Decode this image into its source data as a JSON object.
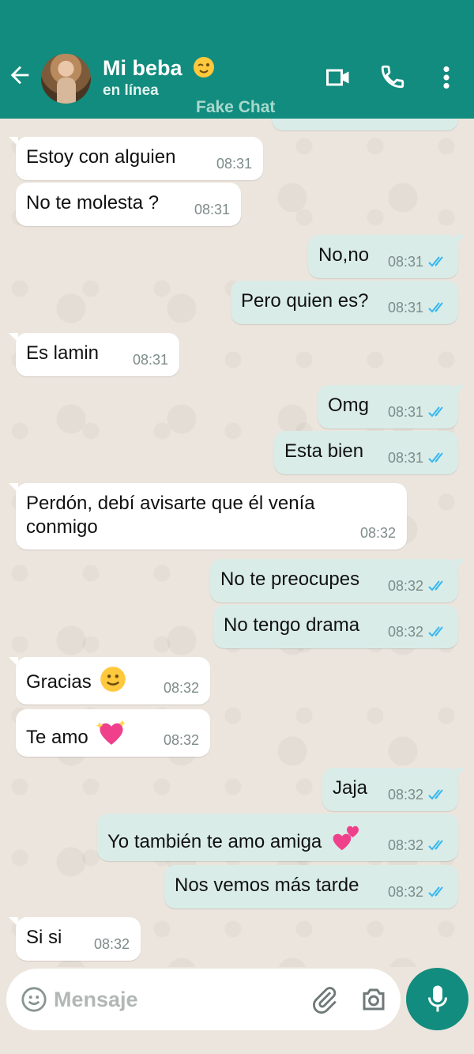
{
  "header": {
    "name": "Mi beba",
    "name_emoji": "winking-face-emoji",
    "status": "en línea",
    "watermark": "Fake Chat",
    "icons": [
      "back-arrow-icon",
      "video-call-icon",
      "phone-icon",
      "more-vert-icon"
    ],
    "background": "#128c7e"
  },
  "messages": [
    {
      "dir": "in",
      "text": "Estoy con alguien",
      "time": "08:31"
    },
    {
      "dir": "in",
      "text": "No te molesta ?",
      "time": "08:31"
    },
    {
      "dir": "out",
      "text": "No,no",
      "time": "08:31",
      "read": true
    },
    {
      "dir": "out",
      "text": "Pero quien es?",
      "time": "08:31",
      "read": true
    },
    {
      "dir": "in",
      "text": "Es lamin",
      "time": "08:31"
    },
    {
      "dir": "out",
      "text": "Omg",
      "time": "08:31",
      "read": true
    },
    {
      "dir": "out",
      "text": "Esta bien",
      "time": "08:31",
      "read": true
    },
    {
      "dir": "in",
      "text": "Perdón, debí avisarte que él venía conmigo",
      "time": "08:32"
    },
    {
      "dir": "out",
      "text": "No te preocupes",
      "time": "08:32",
      "read": true
    },
    {
      "dir": "out",
      "text": "No tengo drama",
      "time": "08:32",
      "read": true
    },
    {
      "dir": "in",
      "text": "Gracias",
      "emoji": "slightly-smiling-face-emoji",
      "time": "08:32"
    },
    {
      "dir": "in",
      "text": "Te amo",
      "emoji": "sparkling-heart-emoji",
      "time": "08:32"
    },
    {
      "dir": "out",
      "text": "Jaja",
      "time": "08:32",
      "read": true
    },
    {
      "dir": "out",
      "text": "Yo también te amo amiga",
      "emoji": "two-hearts-emoji",
      "time": "08:32",
      "read": true
    },
    {
      "dir": "out",
      "text": "Nos vemos más tarde",
      "time": "08:32",
      "read": true
    },
    {
      "dir": "in",
      "text": "Si si",
      "time": "08:32"
    }
  ],
  "input": {
    "placeholder": "Mensaje",
    "icons": [
      "emoji-icon",
      "attach-icon",
      "camera-icon",
      "mic-icon"
    ]
  },
  "colors": {
    "incoming_bubble": "#ffffff",
    "outgoing_bubble": "#d9ece8",
    "read_check": "#34b7f1",
    "chat_background": "#ece5dd"
  }
}
